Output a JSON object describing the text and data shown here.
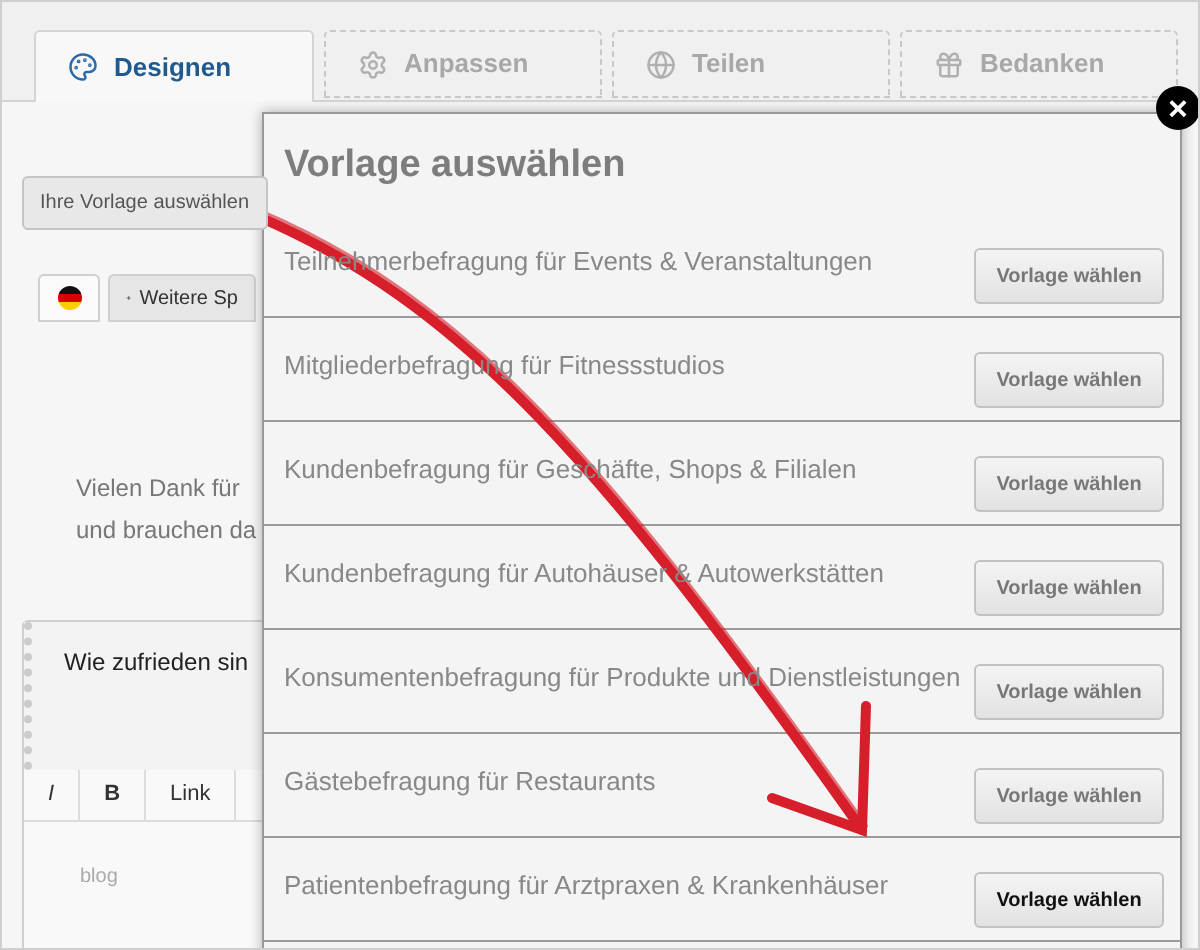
{
  "tabs": [
    {
      "label": "Designen",
      "selected": true
    },
    {
      "label": "Anpassen",
      "selected": false
    },
    {
      "label": "Teilen",
      "selected": false
    },
    {
      "label": "Bedanken",
      "selected": false
    }
  ],
  "template_button": "Ihre Vorlage auswählen",
  "language_tabs": [
    {
      "kind": "flag",
      "selected": true
    },
    {
      "kind": "add",
      "label": "Weitere Sp",
      "selected": false
    }
  ],
  "intro_lines": [
    "Vielen Dank für",
    "und brauchen da"
  ],
  "question": "Wie zufrieden sin",
  "editor_toolbar": [
    "I",
    "B",
    "Link"
  ],
  "editor_placeholder": "blog",
  "modal": {
    "title": "Vorlage auswählen",
    "close": "×",
    "templates": [
      {
        "name": "Teilnehmerbefragung für Events & Veranstaltungen",
        "button": "Vorlage wählen",
        "active": false
      },
      {
        "name": "Mitgliederbefragung für Fitnessstudios",
        "button": "Vorlage wählen",
        "active": false
      },
      {
        "name": "Kundenbefragung für Geschäfte, Shops & Filialen",
        "button": "Vorlage wählen",
        "active": false
      },
      {
        "name": "Kundenbefragung für Autohäuser & Autowerkstätten",
        "button": "Vorlage wählen",
        "active": false
      },
      {
        "name": "Konsumentenbefragung für Produkte und Dienstleistungen",
        "button": "Vorlage wählen",
        "active": false
      },
      {
        "name": "Gästebefragung für Restaurants",
        "button": "Vorlage wählen",
        "active": false
      },
      {
        "name": "Patientenbefragung für Arztpraxen & Krankenhäuser",
        "button": "Vorlage wählen",
        "active": true
      }
    ]
  }
}
